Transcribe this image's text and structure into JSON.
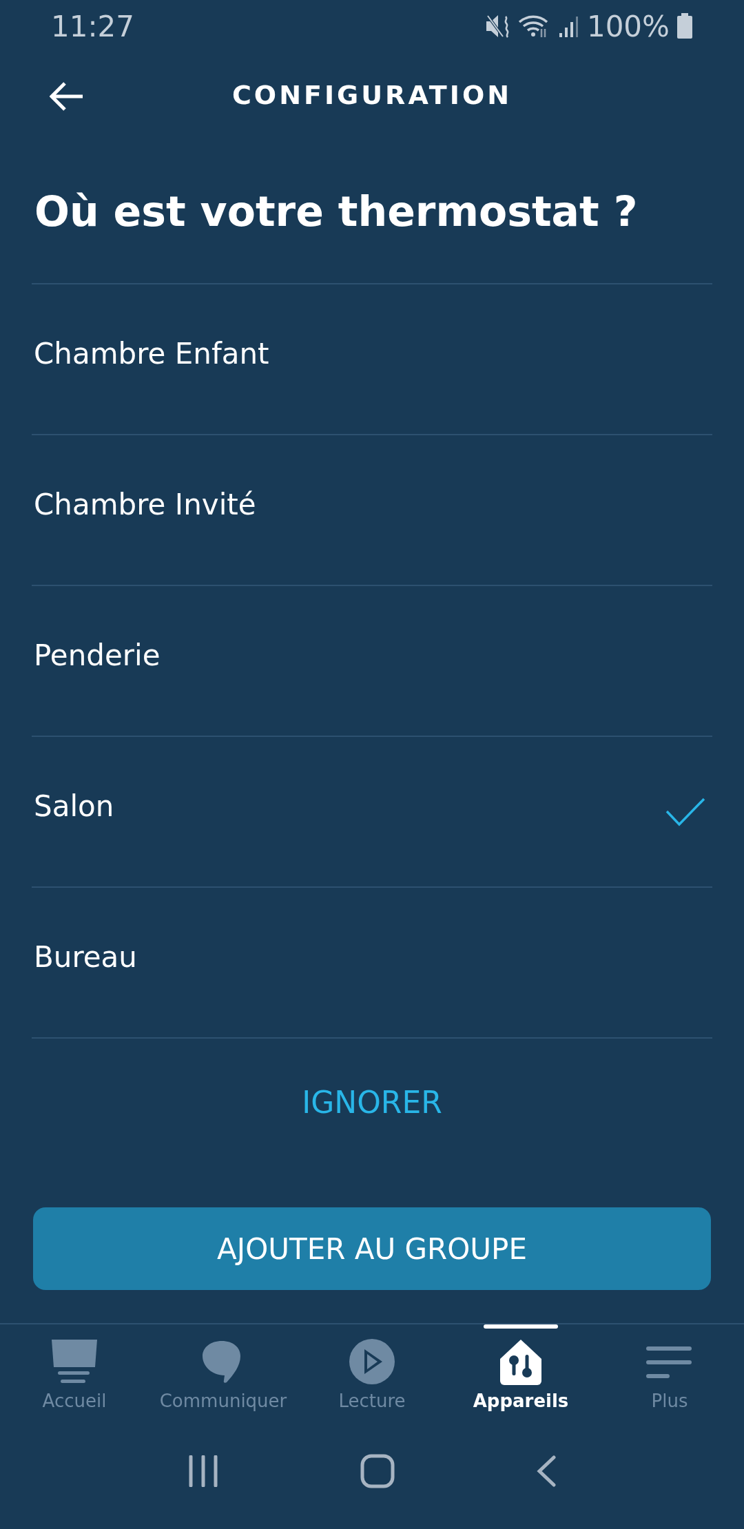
{
  "status_bar": {
    "time": "11:27",
    "battery": "100%"
  },
  "header": {
    "title": "CONFIGURATION"
  },
  "heading": "Où est votre thermostat ?",
  "rooms": [
    {
      "label": "Chambre Enfant",
      "selected": false
    },
    {
      "label": "Chambre Invité",
      "selected": false
    },
    {
      "label": "Penderie",
      "selected": false
    },
    {
      "label": "Salon",
      "selected": true
    },
    {
      "label": "Bureau",
      "selected": false
    }
  ],
  "skip_link": "IGNORER",
  "primary_button": "AJOUTER AU GROUPE",
  "bottom_nav": [
    {
      "label": "Accueil",
      "selected": false
    },
    {
      "label": "Communiquer",
      "selected": false
    },
    {
      "label": "Lecture",
      "selected": false
    },
    {
      "label": "Appareils",
      "selected": true
    },
    {
      "label": "Plus",
      "selected": false
    }
  ]
}
